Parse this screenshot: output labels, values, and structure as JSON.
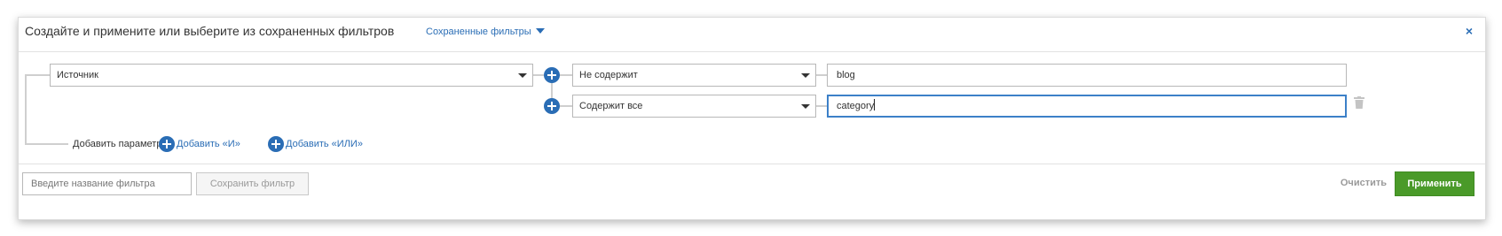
{
  "header": {
    "title": "Создайте и примените или выберите из сохраненных фильтров",
    "saved_filters_label": "Сохраненные фильтры",
    "close_label": "×"
  },
  "filter": {
    "parameter": {
      "value": "Источник",
      "icon": "chevron-down-icon"
    },
    "conditions": [
      {
        "operator": "Не содержит",
        "value": "blog"
      },
      {
        "operator": "Содержит все",
        "value": "category"
      }
    ]
  },
  "add_parameter": {
    "label": "Добавить параметр:",
    "and_label": "Добавить «И»",
    "or_label": "Добавить «ИЛИ»"
  },
  "footer": {
    "filter_name_placeholder": "Введите название фильтра",
    "save_label": "Сохранить фильтр",
    "clear_label": "Очистить",
    "apply_label": "Применить"
  },
  "colors": {
    "link": "#2a6db5",
    "apply": "#4a9a29",
    "focus": "#3c80c8"
  }
}
